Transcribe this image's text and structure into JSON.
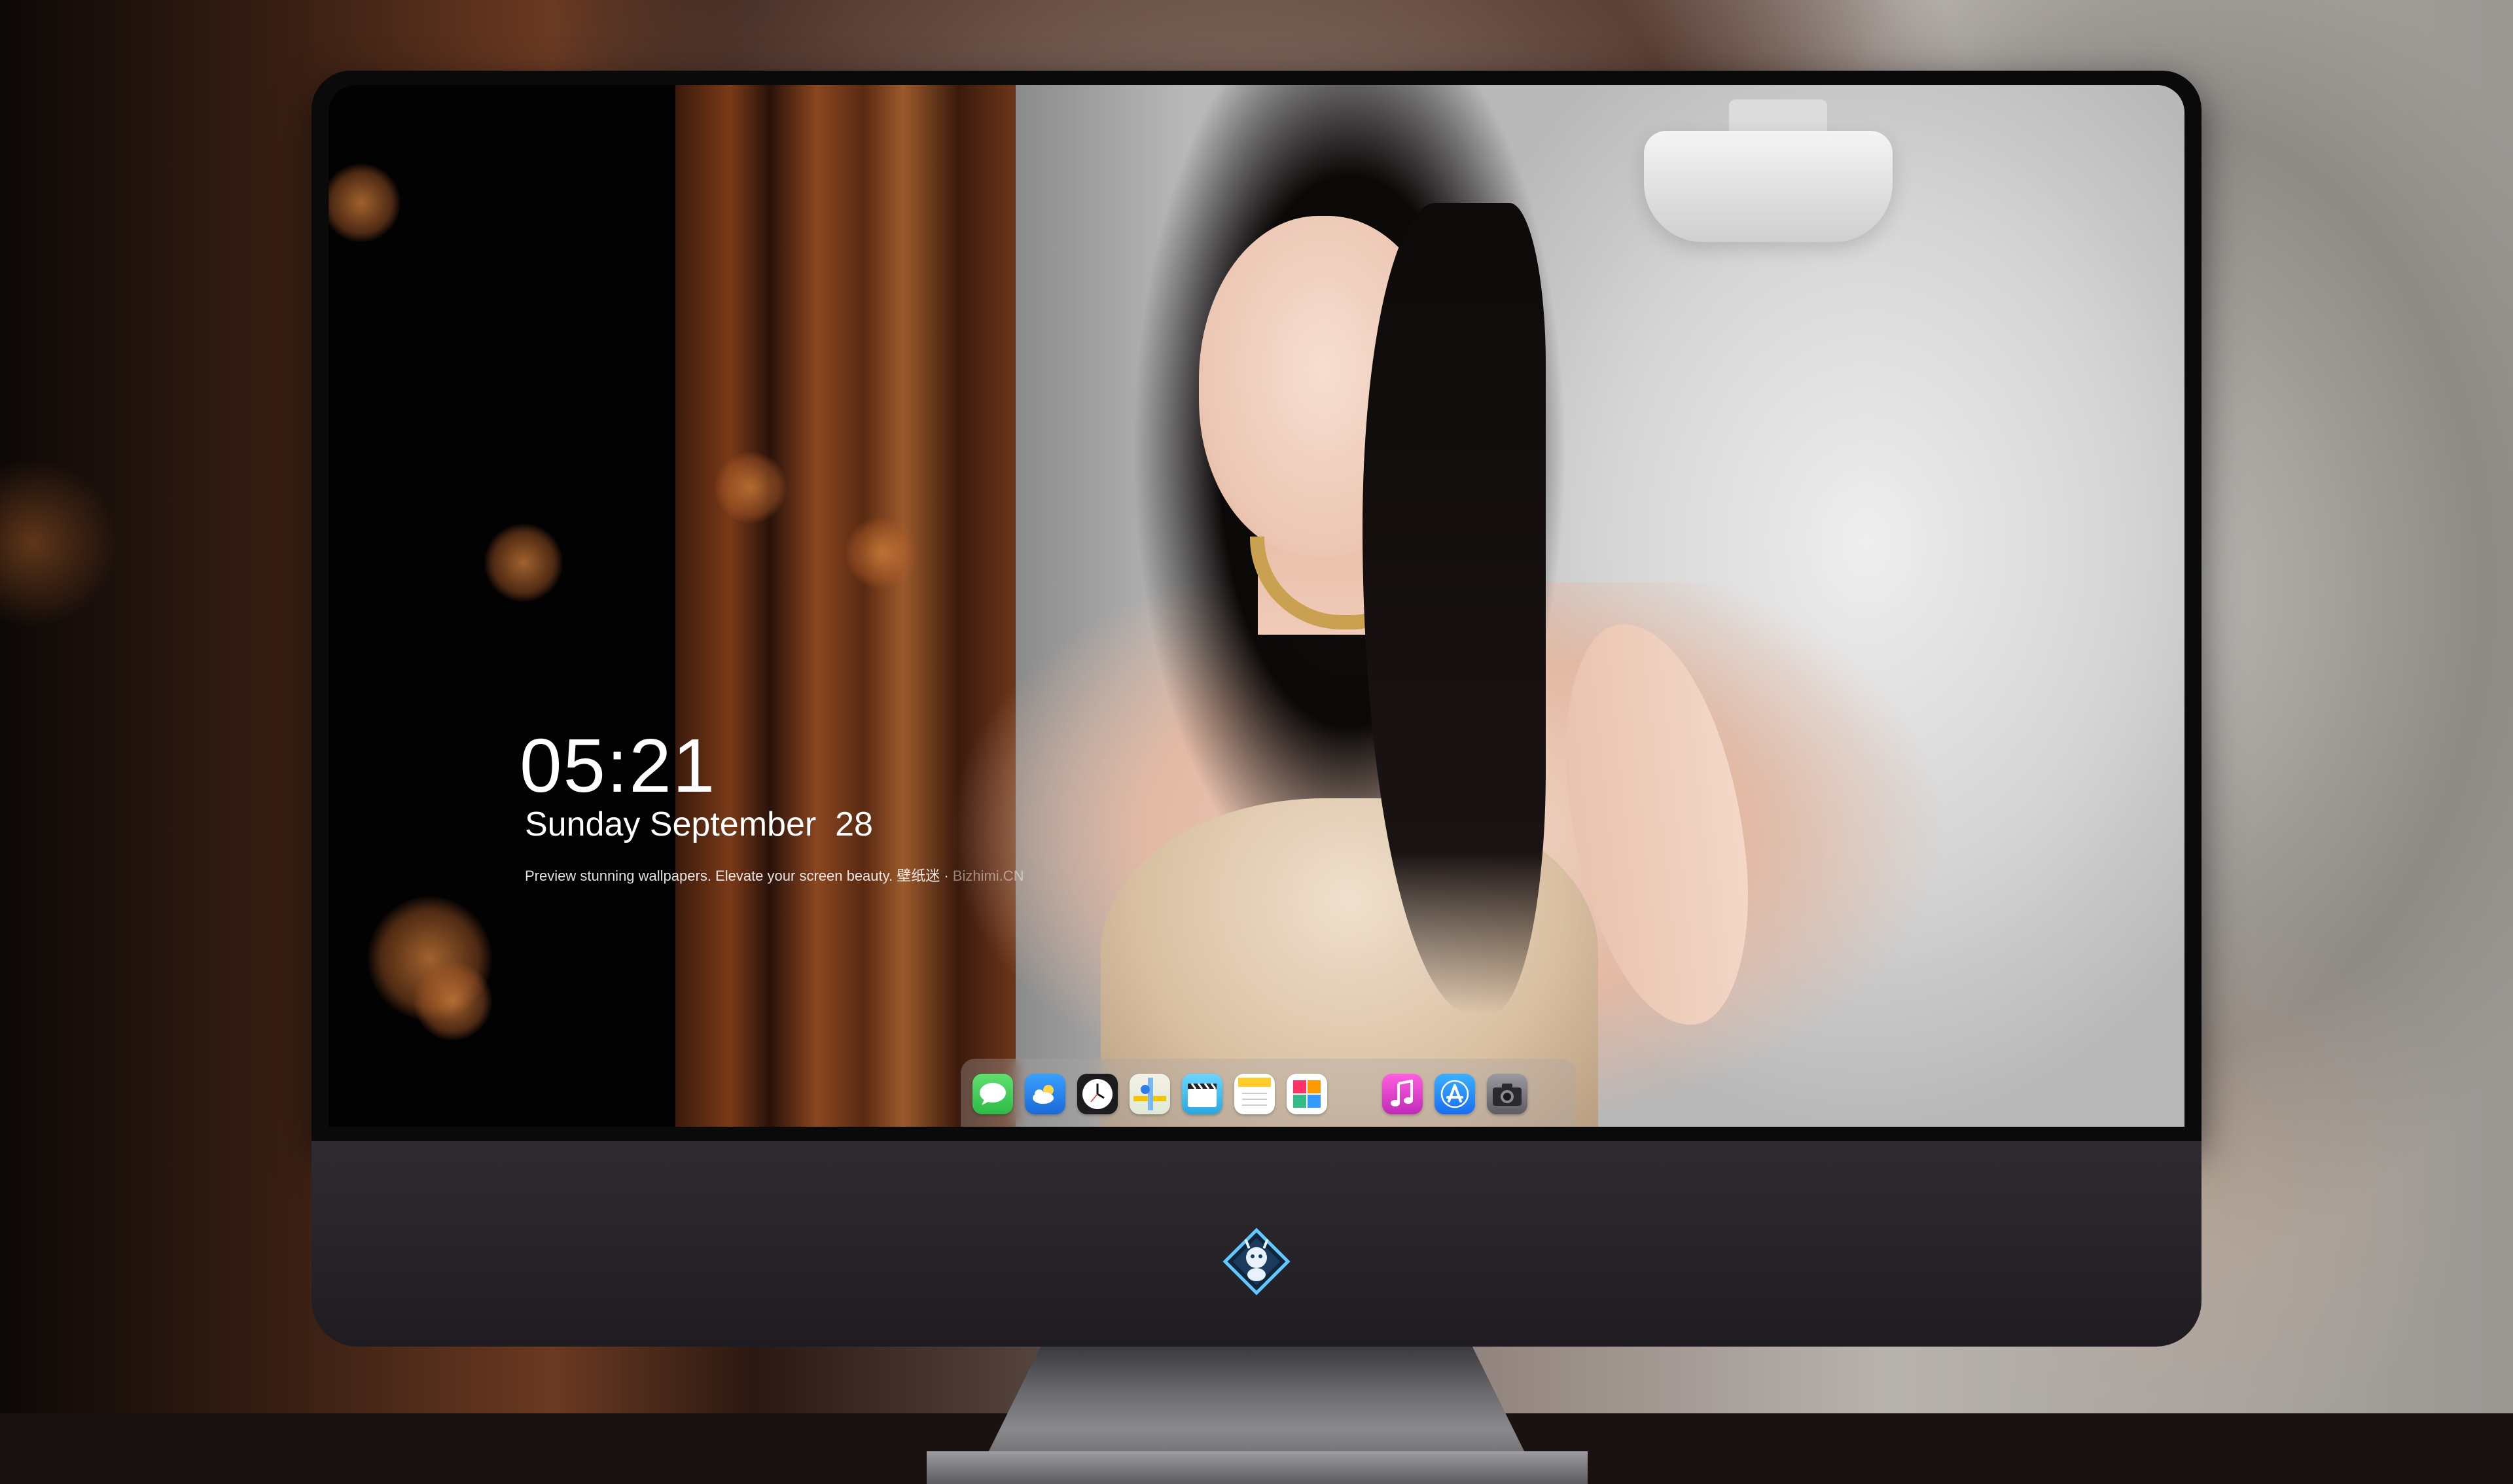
{
  "lockscreen": {
    "time": "05:21",
    "date": "Sunday September  28",
    "tagline": "Preview stunning wallpapers. Elevate your screen beauty. 壁纸迷 · ",
    "tagline_dim": "Bizhimi.CN"
  },
  "dock": {
    "apps": [
      {
        "name": "messages",
        "icon": "messages-icon",
        "color": "#34c759"
      },
      {
        "name": "weather",
        "icon": "weather-icon",
        "color": "#2f8ff0"
      },
      {
        "name": "clock",
        "icon": "clock-icon",
        "color": "#ffffff"
      },
      {
        "name": "maps",
        "icon": "maps-icon",
        "color": "#4a90d9"
      },
      {
        "name": "videos",
        "icon": "clapperboard-icon",
        "color": "#57c7f0"
      },
      {
        "name": "notes",
        "icon": "notes-icon",
        "color": "#ffd02c"
      },
      {
        "name": "photos",
        "icon": "photos-icon",
        "color": "#6cc04a"
      },
      {
        "name": "music",
        "icon": "music-note-icon",
        "color": "#e94bd6"
      },
      {
        "name": "app-store",
        "icon": "app-store-icon",
        "color": "#2d8cf0"
      },
      {
        "name": "camera",
        "icon": "camera-icon",
        "color": "#7c7c80"
      }
    ]
  },
  "monitor": {
    "logo": "dragon-diamond-logo"
  }
}
